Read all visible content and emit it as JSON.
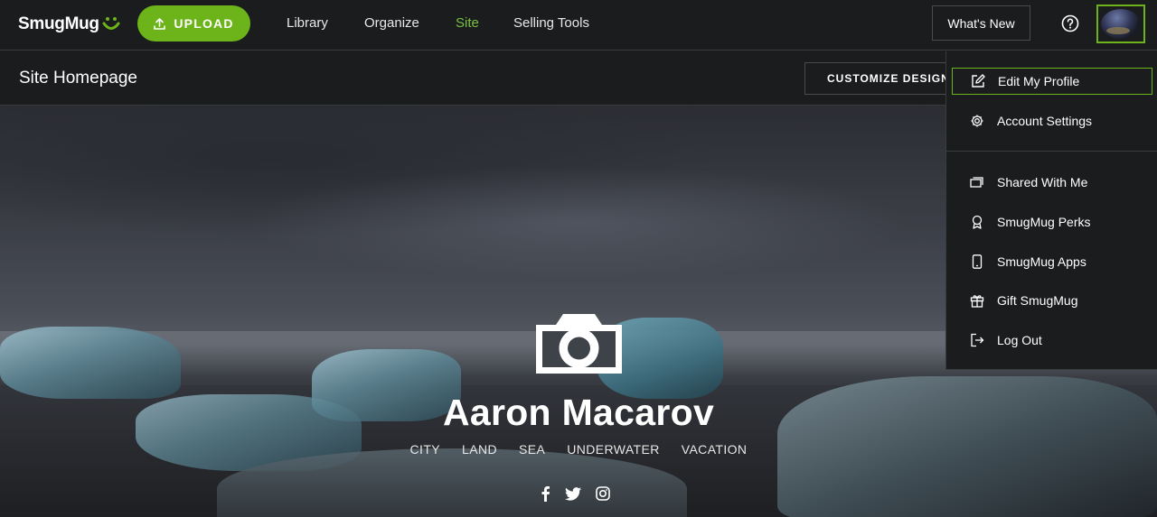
{
  "brand": {
    "logo_text": "SmugMug",
    "accent": "#6db41a",
    "active_nav": "#7ac142"
  },
  "topbar": {
    "upload_label": "UPLOAD",
    "nav": [
      {
        "label": "Library"
      },
      {
        "label": "Organize"
      },
      {
        "label": "Site",
        "active": true
      },
      {
        "label": "Selling Tools"
      }
    ],
    "whats_new_label": "What's New",
    "help_icon": "question-circle-icon",
    "avatar_icon": "user-avatar"
  },
  "subbar": {
    "title": "Site Homepage",
    "customize_label": "CUSTOMIZE DESIGN"
  },
  "hero": {
    "owner_name": "Aaron Macarov",
    "galleries": [
      "CITY",
      "LAND",
      "SEA",
      "UNDERWATER",
      "VACATION"
    ],
    "social_icons": [
      "facebook-icon",
      "twitter-icon",
      "instagram-icon"
    ]
  },
  "dropdown": {
    "items": [
      {
        "label": "Edit My Profile",
        "icon": "edit-icon",
        "selected": true
      },
      {
        "label": "Account Settings",
        "icon": "gear-icon"
      },
      {
        "label": "Shared With Me",
        "icon": "stacked-windows-icon"
      },
      {
        "label": "SmugMug Perks",
        "icon": "award-ribbon-icon"
      },
      {
        "label": "SmugMug Apps",
        "icon": "mobile-phone-icon"
      },
      {
        "label": "Gift SmugMug",
        "icon": "gift-icon"
      },
      {
        "label": "Log Out",
        "icon": "logout-icon"
      }
    ]
  }
}
